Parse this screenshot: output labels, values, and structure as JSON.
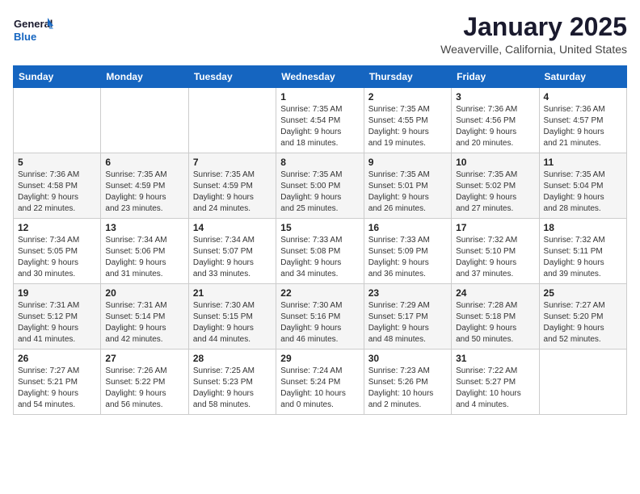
{
  "header": {
    "logo_general": "General",
    "logo_blue": "Blue",
    "month": "January 2025",
    "location": "Weaverville, California, United States"
  },
  "days_of_week": [
    "Sunday",
    "Monday",
    "Tuesday",
    "Wednesday",
    "Thursday",
    "Friday",
    "Saturday"
  ],
  "weeks": [
    [
      {
        "day": "",
        "info": ""
      },
      {
        "day": "",
        "info": ""
      },
      {
        "day": "",
        "info": ""
      },
      {
        "day": "1",
        "info": "Sunrise: 7:35 AM\nSunset: 4:54 PM\nDaylight: 9 hours\nand 18 minutes."
      },
      {
        "day": "2",
        "info": "Sunrise: 7:35 AM\nSunset: 4:55 PM\nDaylight: 9 hours\nand 19 minutes."
      },
      {
        "day": "3",
        "info": "Sunrise: 7:36 AM\nSunset: 4:56 PM\nDaylight: 9 hours\nand 20 minutes."
      },
      {
        "day": "4",
        "info": "Sunrise: 7:36 AM\nSunset: 4:57 PM\nDaylight: 9 hours\nand 21 minutes."
      }
    ],
    [
      {
        "day": "5",
        "info": "Sunrise: 7:36 AM\nSunset: 4:58 PM\nDaylight: 9 hours\nand 22 minutes."
      },
      {
        "day": "6",
        "info": "Sunrise: 7:35 AM\nSunset: 4:59 PM\nDaylight: 9 hours\nand 23 minutes."
      },
      {
        "day": "7",
        "info": "Sunrise: 7:35 AM\nSunset: 4:59 PM\nDaylight: 9 hours\nand 24 minutes."
      },
      {
        "day": "8",
        "info": "Sunrise: 7:35 AM\nSunset: 5:00 PM\nDaylight: 9 hours\nand 25 minutes."
      },
      {
        "day": "9",
        "info": "Sunrise: 7:35 AM\nSunset: 5:01 PM\nDaylight: 9 hours\nand 26 minutes."
      },
      {
        "day": "10",
        "info": "Sunrise: 7:35 AM\nSunset: 5:02 PM\nDaylight: 9 hours\nand 27 minutes."
      },
      {
        "day": "11",
        "info": "Sunrise: 7:35 AM\nSunset: 5:04 PM\nDaylight: 9 hours\nand 28 minutes."
      }
    ],
    [
      {
        "day": "12",
        "info": "Sunrise: 7:34 AM\nSunset: 5:05 PM\nDaylight: 9 hours\nand 30 minutes."
      },
      {
        "day": "13",
        "info": "Sunrise: 7:34 AM\nSunset: 5:06 PM\nDaylight: 9 hours\nand 31 minutes."
      },
      {
        "day": "14",
        "info": "Sunrise: 7:34 AM\nSunset: 5:07 PM\nDaylight: 9 hours\nand 33 minutes."
      },
      {
        "day": "15",
        "info": "Sunrise: 7:33 AM\nSunset: 5:08 PM\nDaylight: 9 hours\nand 34 minutes."
      },
      {
        "day": "16",
        "info": "Sunrise: 7:33 AM\nSunset: 5:09 PM\nDaylight: 9 hours\nand 36 minutes."
      },
      {
        "day": "17",
        "info": "Sunrise: 7:32 AM\nSunset: 5:10 PM\nDaylight: 9 hours\nand 37 minutes."
      },
      {
        "day": "18",
        "info": "Sunrise: 7:32 AM\nSunset: 5:11 PM\nDaylight: 9 hours\nand 39 minutes."
      }
    ],
    [
      {
        "day": "19",
        "info": "Sunrise: 7:31 AM\nSunset: 5:12 PM\nDaylight: 9 hours\nand 41 minutes."
      },
      {
        "day": "20",
        "info": "Sunrise: 7:31 AM\nSunset: 5:14 PM\nDaylight: 9 hours\nand 42 minutes."
      },
      {
        "day": "21",
        "info": "Sunrise: 7:30 AM\nSunset: 5:15 PM\nDaylight: 9 hours\nand 44 minutes."
      },
      {
        "day": "22",
        "info": "Sunrise: 7:30 AM\nSunset: 5:16 PM\nDaylight: 9 hours\nand 46 minutes."
      },
      {
        "day": "23",
        "info": "Sunrise: 7:29 AM\nSunset: 5:17 PM\nDaylight: 9 hours\nand 48 minutes."
      },
      {
        "day": "24",
        "info": "Sunrise: 7:28 AM\nSunset: 5:18 PM\nDaylight: 9 hours\nand 50 minutes."
      },
      {
        "day": "25",
        "info": "Sunrise: 7:27 AM\nSunset: 5:20 PM\nDaylight: 9 hours\nand 52 minutes."
      }
    ],
    [
      {
        "day": "26",
        "info": "Sunrise: 7:27 AM\nSunset: 5:21 PM\nDaylight: 9 hours\nand 54 minutes."
      },
      {
        "day": "27",
        "info": "Sunrise: 7:26 AM\nSunset: 5:22 PM\nDaylight: 9 hours\nand 56 minutes."
      },
      {
        "day": "28",
        "info": "Sunrise: 7:25 AM\nSunset: 5:23 PM\nDaylight: 9 hours\nand 58 minutes."
      },
      {
        "day": "29",
        "info": "Sunrise: 7:24 AM\nSunset: 5:24 PM\nDaylight: 10 hours\nand 0 minutes."
      },
      {
        "day": "30",
        "info": "Sunrise: 7:23 AM\nSunset: 5:26 PM\nDaylight: 10 hours\nand 2 minutes."
      },
      {
        "day": "31",
        "info": "Sunrise: 7:22 AM\nSunset: 5:27 PM\nDaylight: 10 hours\nand 4 minutes."
      },
      {
        "day": "",
        "info": ""
      }
    ]
  ]
}
